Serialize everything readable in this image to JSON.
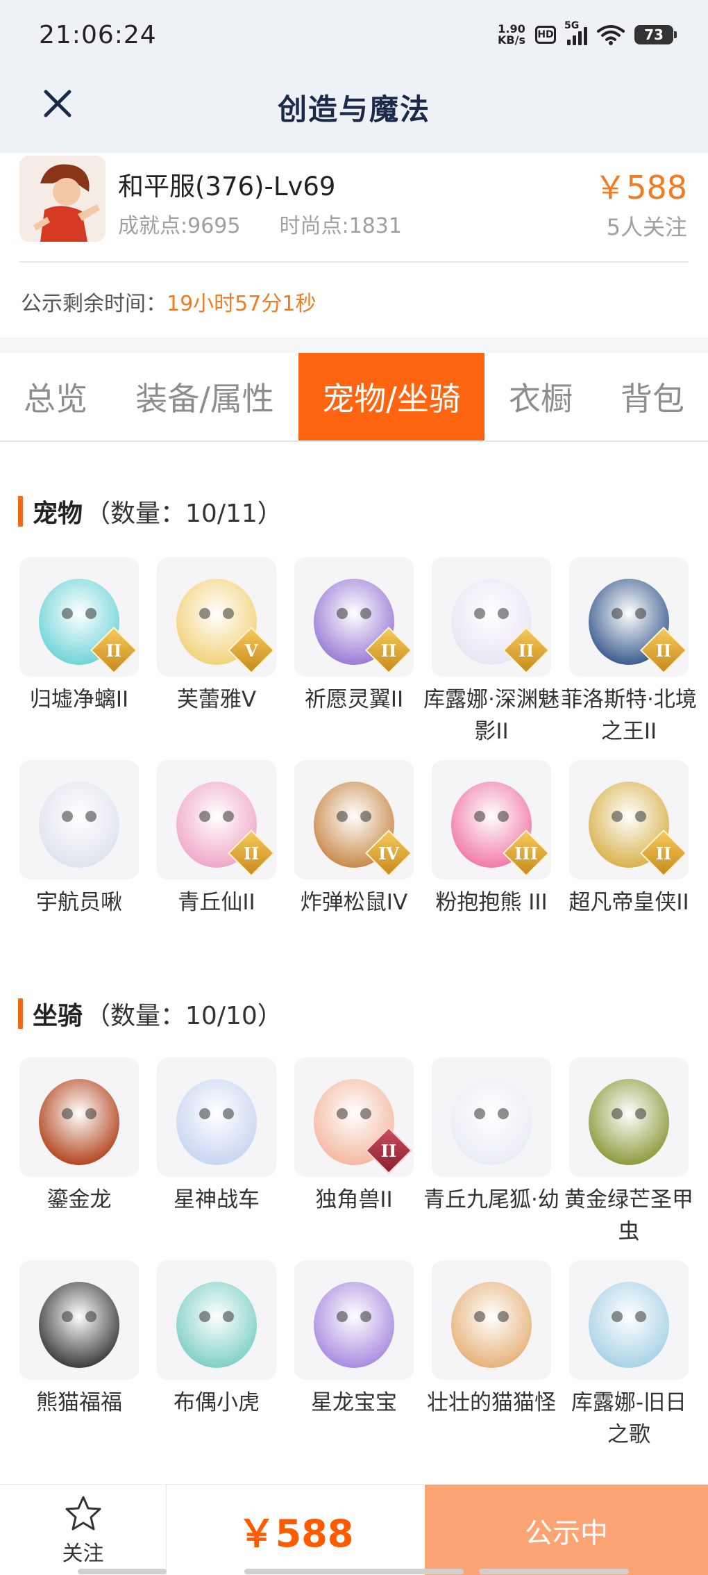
{
  "status_bar": {
    "time": "21:06:24",
    "net_speed_value": "1.90",
    "net_speed_unit": "KB/s",
    "hd_label": "HD",
    "signal_label": "5G",
    "battery": "73"
  },
  "header": {
    "title": "创造与魔法",
    "close_icon": "close-icon"
  },
  "account": {
    "name": "和平服(376)-Lv69",
    "achievement": "成就点:9695",
    "fashion": "时尚点:1831",
    "price": "￥588",
    "followers": "5人关注",
    "remaining_label": "公示剩余时间：",
    "remaining_value": "19小时57分1秒"
  },
  "tabs": [
    {
      "label": "总览",
      "active": false
    },
    {
      "label": "装备/属性",
      "active": false
    },
    {
      "label": "宠物/坐骑",
      "active": true
    },
    {
      "label": "衣橱",
      "active": false
    },
    {
      "label": "背包",
      "active": false
    }
  ],
  "pets": {
    "title": "宠物",
    "count": "（数量：10/11）",
    "items": [
      {
        "name": "归墟净螭II",
        "badge": "II",
        "color": "#6fd4d8"
      },
      {
        "name": "芙蕾雅V",
        "badge": "V",
        "color": "#f2d27a"
      },
      {
        "name": "祈愿灵翼II",
        "badge": "II",
        "color": "#9a7bd6"
      },
      {
        "name": "库露娜·深渊魅影II",
        "badge": "II",
        "color": "#e9e4f4"
      },
      {
        "name": "菲洛斯特·北境之王II",
        "badge": "II",
        "color": "#3b5c8e"
      },
      {
        "name": "宇航员啾",
        "badge": "",
        "color": "#dfe3ee"
      },
      {
        "name": "青丘仙II",
        "badge": "II",
        "color": "#f0a7c8"
      },
      {
        "name": "炸弹松鼠IV",
        "badge": "IV",
        "color": "#c98a4a"
      },
      {
        "name": "粉抱抱熊 III",
        "badge": "III",
        "color": "#f07aa8"
      },
      {
        "name": "超凡帝皇侠II",
        "badge": "II",
        "color": "#d9b24c"
      }
    ]
  },
  "mounts": {
    "title": "坐骑",
    "count": "（数量：10/10）",
    "items": [
      {
        "name": "鎏金龙",
        "badge": "",
        "color": "#b3451e"
      },
      {
        "name": "星神战车",
        "badge": "",
        "color": "#c8d6f2"
      },
      {
        "name": "独角兽II",
        "badge": "II",
        "color": "#f4b9a0"
      },
      {
        "name": "青丘九尾狐·幼",
        "badge": "",
        "color": "#e9ecf5"
      },
      {
        "name": "黄金绿芒圣甲虫",
        "badge": "",
        "color": "#8e9a3c"
      },
      {
        "name": "熊猫福福",
        "badge": "",
        "color": "#3c3c3c"
      },
      {
        "name": "布偶小虎",
        "badge": "",
        "color": "#7fd0c6"
      },
      {
        "name": "星龙宝宝",
        "badge": "",
        "color": "#a98be0"
      },
      {
        "name": "壮壮的猫猫怪",
        "badge": "",
        "color": "#e7b27a"
      },
      {
        "name": "库露娜-旧日之歌",
        "badge": "",
        "color": "#a9d2e6"
      }
    ]
  },
  "bottom": {
    "follow_label": "关注",
    "price": "￥588",
    "status": "公示中",
    "accent": "#ff6410"
  }
}
